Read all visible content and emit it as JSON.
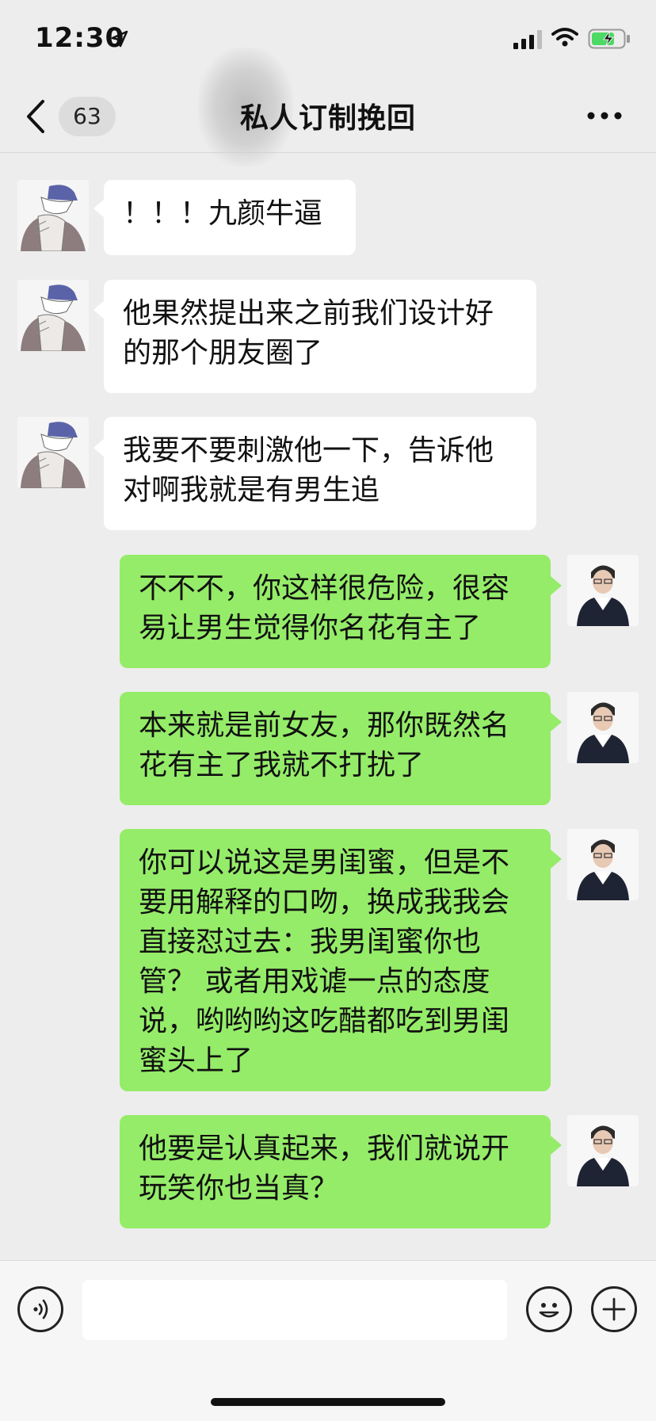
{
  "status_bar": {
    "time": "12:30",
    "icons": [
      "location-arrow-icon",
      "signal-icon",
      "wifi-icon",
      "battery-charging-icon"
    ]
  },
  "header": {
    "back_icon": "chevron-left-icon",
    "unread_count": "63",
    "title": "私人订制挽回",
    "more_icon": "more-dots-icon"
  },
  "messages": [
    {
      "side": "left",
      "text": "！！！九颜牛逼"
    },
    {
      "side": "left",
      "text": "他果然提出来之前我们设计好的那个朋友圈了"
    },
    {
      "side": "left",
      "text": "我要不要刺激他一下，告诉他对啊我就是有男生追"
    },
    {
      "side": "right",
      "text": "不不不，你这样很危险，很容易让男生觉得你名花有主了"
    },
    {
      "side": "right",
      "text": "本来就是前女友，那你既然名花有主了我就不打扰了"
    },
    {
      "side": "right",
      "text": "你可以说这是男闺蜜，但是不要用解释的口吻，换成我我会直接怼过去：我男闺蜜你也管？ 或者用戏谑一点的态度说，哟哟哟这吃醋都吃到男闺蜜头上了"
    },
    {
      "side": "right",
      "text": "他要是认真起来，我们就说开玩笑你也当真？"
    }
  ],
  "input_bar": {
    "value": "",
    "icons": [
      "voice-icon",
      "emoji-icon",
      "plus-icon"
    ]
  },
  "colors": {
    "background": "#ededed",
    "outgoing_bubble": "#95ec69",
    "incoming_bubble": "#ffffff",
    "battery": "#4cd964"
  }
}
